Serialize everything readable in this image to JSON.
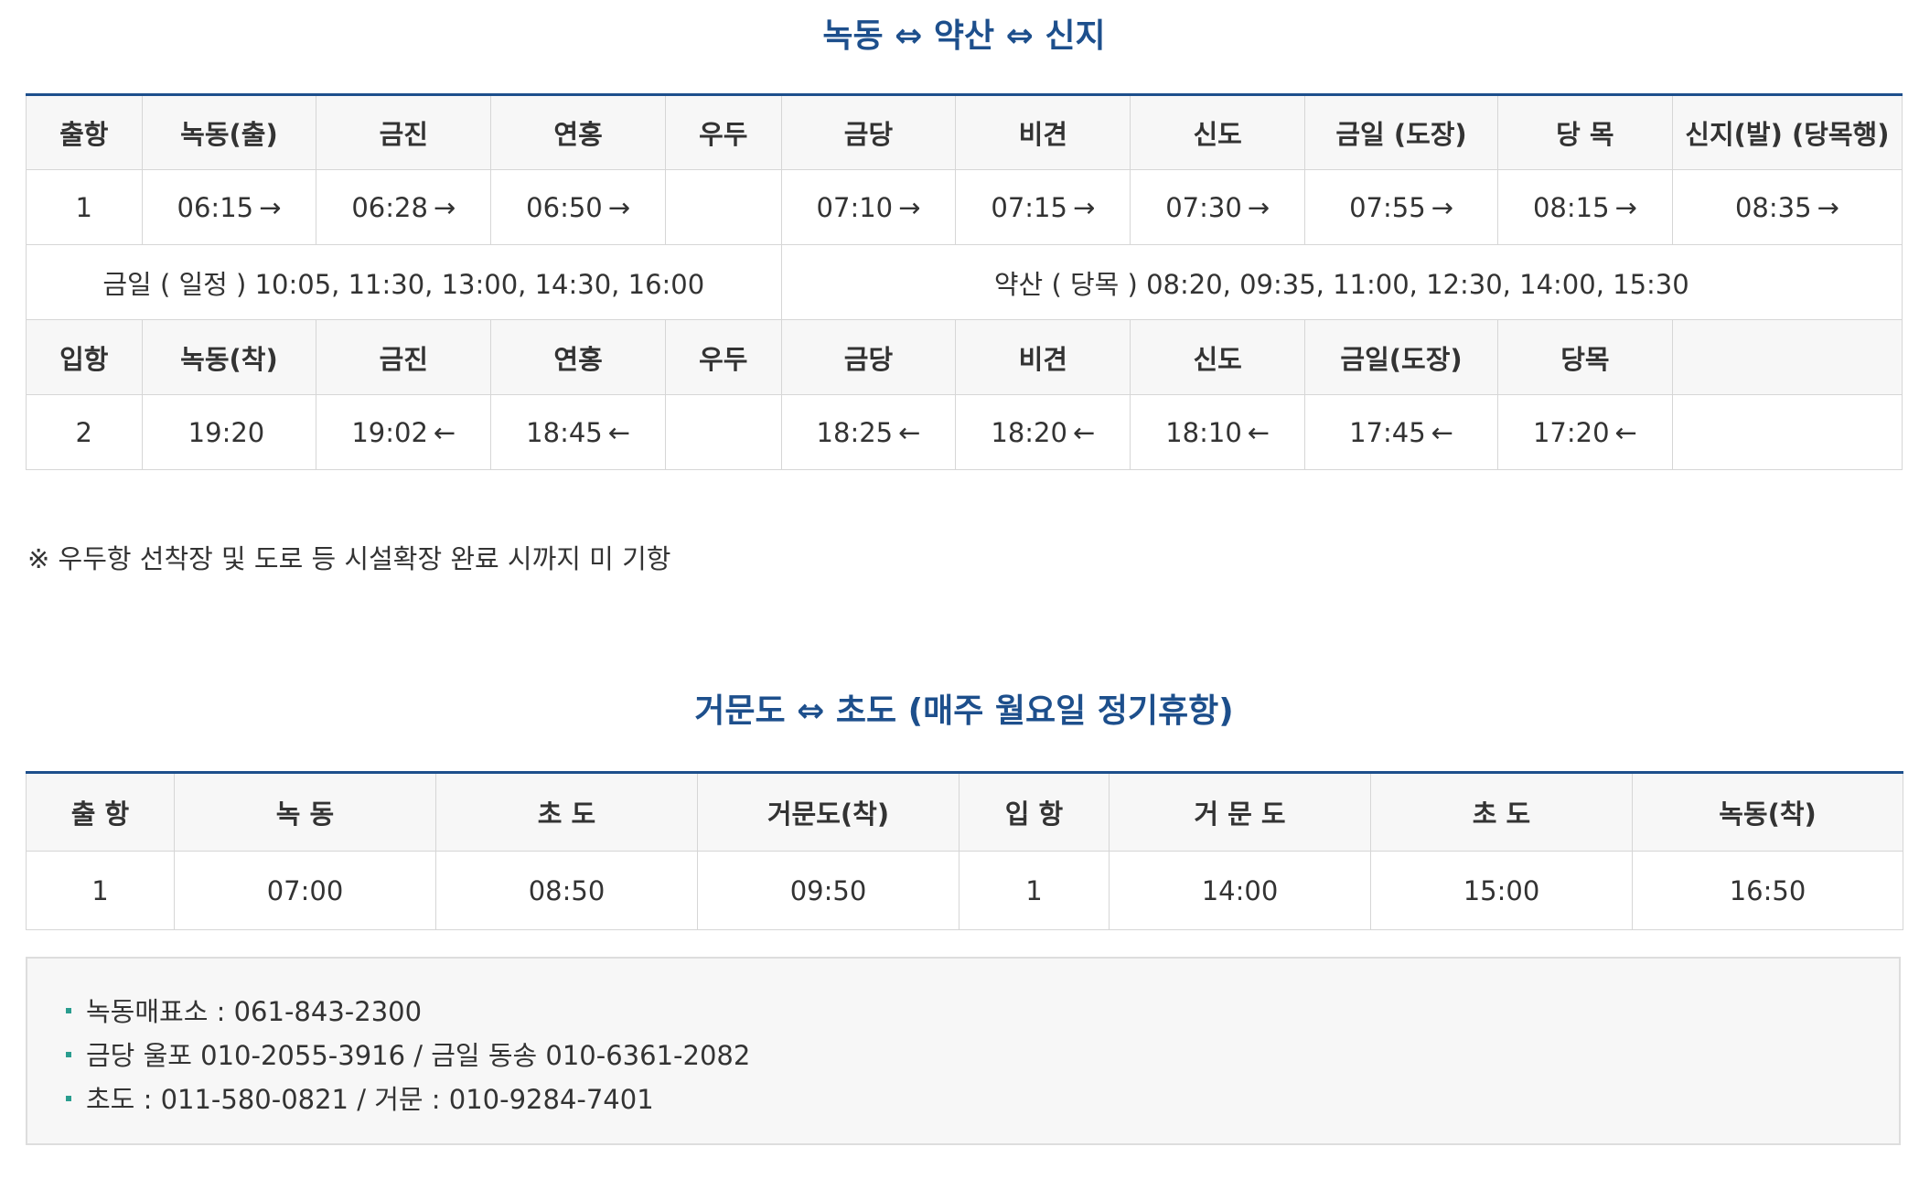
{
  "route1": {
    "title": "녹동 ⇔ 약산 ⇔ 신지",
    "departure_header": [
      "출항",
      "녹동(출)",
      "금진",
      "연홍",
      "우두",
      "금당",
      "비견",
      "신도",
      "금일 (도장)",
      "당 목",
      "신지(발) (당목행)"
    ],
    "departure_row": {
      "no": "1",
      "times": [
        {
          "time": "06:15",
          "arrow": "→"
        },
        {
          "time": "06:28",
          "arrow": "→"
        },
        {
          "time": "06:50",
          "arrow": "→"
        },
        {
          "time": "",
          "arrow": ""
        },
        {
          "time": "07:10",
          "arrow": "→"
        },
        {
          "time": "07:15",
          "arrow": "→"
        },
        {
          "time": "07:30",
          "arrow": "→"
        },
        {
          "time": "07:55",
          "arrow": "→"
        },
        {
          "time": "08:15",
          "arrow": "→"
        },
        {
          "time": "08:35",
          "arrow": "→"
        }
      ]
    },
    "extra_left": "금일 ( 일정 ) 10:05, 11:30, 13:00, 14:30, 16:00",
    "extra_right": "약산 ( 당목 ) 08:20, 09:35, 11:00, 12:30, 14:00, 15:30",
    "arrival_header": [
      "입항",
      "녹동(착)",
      "금진",
      "연홍",
      "우두",
      "금당",
      "비견",
      "신도",
      "금일(도장)",
      "당목",
      ""
    ],
    "arrival_row": {
      "no": "2",
      "times": [
        {
          "time": "19:20",
          "arrow": ""
        },
        {
          "time": "19:02",
          "arrow": "←"
        },
        {
          "time": "18:45",
          "arrow": "←"
        },
        {
          "time": "",
          "arrow": ""
        },
        {
          "time": "18:25",
          "arrow": "←"
        },
        {
          "time": "18:20",
          "arrow": "←"
        },
        {
          "time": "18:10",
          "arrow": "←"
        },
        {
          "time": "17:45",
          "arrow": "←"
        },
        {
          "time": "17:20",
          "arrow": "←"
        },
        {
          "time": "",
          "arrow": ""
        }
      ]
    },
    "note": "※ 우두항 선착장 및 도로 등 시설확장 완료 시까지 미 기항"
  },
  "route2": {
    "title": "거문도 ⇔ 초도 (매주 월요일 정기휴항)",
    "header": [
      "출 항",
      "녹 동",
      "초 도",
      "거문도(착)",
      "입 항",
      "거 문 도",
      "초 도",
      "녹동(착)"
    ],
    "row": [
      "1",
      "07:00",
      "08:50",
      "09:50",
      "1",
      "14:00",
      "15:00",
      "16:50"
    ]
  },
  "contacts": [
    "녹동매표소 : 061-843-2300",
    "금당 울포 010-2055-3916 / 금일 동송 010-6361-2082",
    "초도 : 011-580-0821 / 거문 : 010-9284-7401"
  ],
  "colors": {
    "title": "#1d4f8c",
    "table_top_border": "#1d4f8c",
    "header_bg": "#f7f7f7",
    "bullet": "#2a9d8f"
  }
}
